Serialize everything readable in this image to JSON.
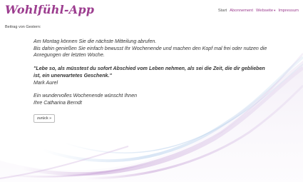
{
  "header": {
    "title": "Wohlfühl-App",
    "nav": [
      {
        "label": "Start"
      },
      {
        "label": "Abonnement"
      },
      {
        "label": "Webseite"
      },
      {
        "label": "Impressum"
      }
    ]
  },
  "main": {
    "previous_label": "Beitrag von Gestern:",
    "intro_line1": "Am Montag können Sie die nächste Mitteilung abrufen.",
    "intro_line2": "Bis dahin genießen Sie einfach bewusst Ihr Wochenende und machen den Kopf mal frei oder nutzen die Anregungen der letzten Woche.",
    "quote": "\"Lebe so, als müsstest du sofort Abschied vom Leben nehmen, als sei die Zeit, die dir geblieben ist, ein unerwartetes Geschenk.\"",
    "quote_author": "Mark Aurel",
    "closing_line1": "Ein wundervolles Wochenende wünscht Ihnen",
    "closing_line2": "Ihre Catharina Berndt",
    "back_button": "zurück »"
  },
  "colors": {
    "accent": "#9c3d8f",
    "wave_purple": "#c9a5d8",
    "wave_blue": "#a8c6e8"
  }
}
